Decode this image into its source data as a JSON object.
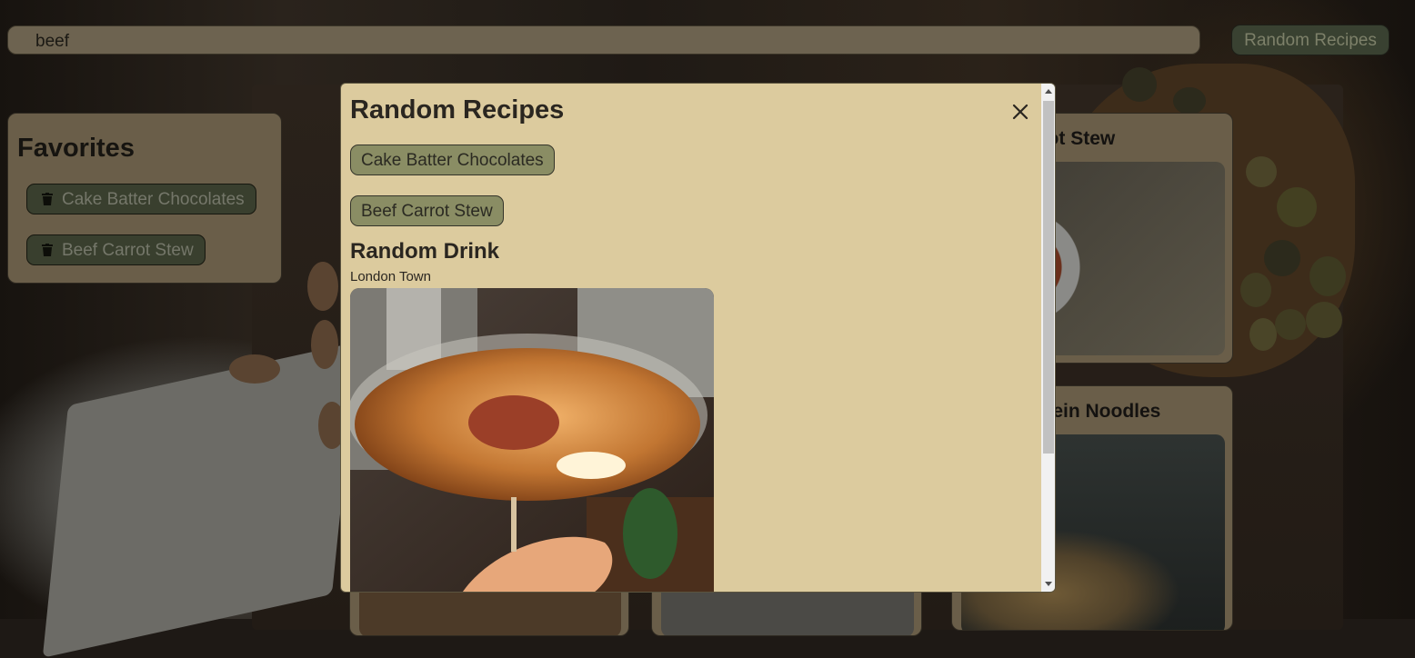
{
  "search": {
    "value": "beef"
  },
  "header": {
    "random_button_label": "Random Recipes"
  },
  "favorites": {
    "title": "Favorites",
    "items": [
      {
        "label": "Cake Batter Chocolates",
        "icon": "trash-icon"
      },
      {
        "label": "Beef Carrot Stew",
        "icon": "trash-icon"
      }
    ]
  },
  "meals": [
    {
      "title": "Beef Carrot Stew"
    },
    {
      "title": "Beef Lo Mein Noodles"
    }
  ],
  "modal": {
    "title": "Random Recipes",
    "close_icon": "close-icon",
    "recipes": [
      {
        "label": "Cake Batter Chocolates"
      },
      {
        "label": "Beef Carrot Stew"
      }
    ],
    "drink_heading": "Random Drink",
    "drink_name": "London Town"
  },
  "colors": {
    "modal_bg": "#dccb9e",
    "button_bg": "#8a8d64",
    "panel_bg": "#6a5e49"
  }
}
